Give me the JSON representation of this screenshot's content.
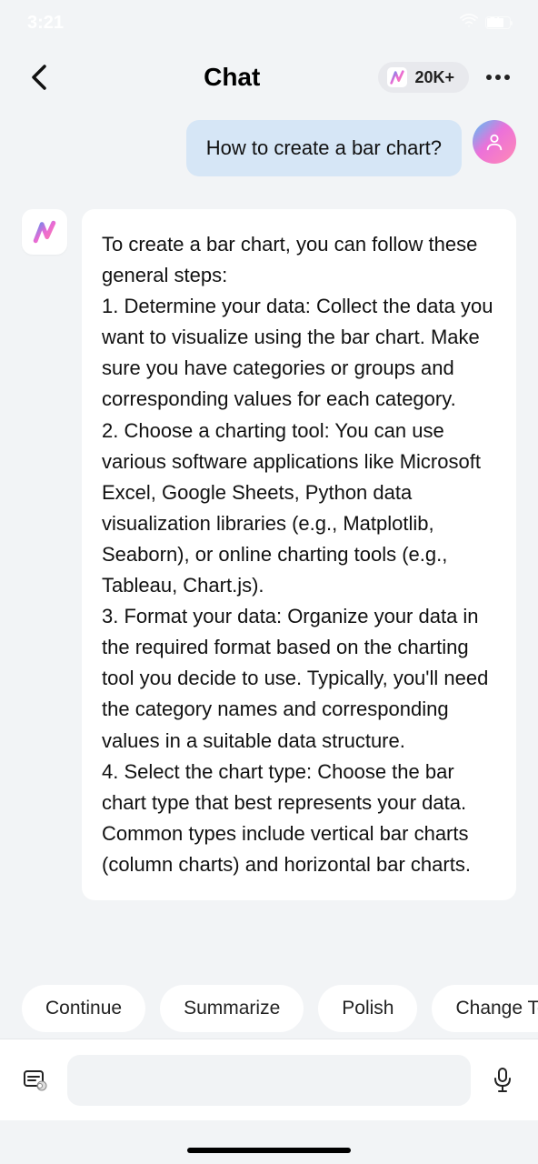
{
  "status": {
    "time": "3:21",
    "battery": "74"
  },
  "nav": {
    "title": "Chat",
    "count": "20K+"
  },
  "chat": {
    "userMessage": "How to create a bar chart?",
    "botIntro": "To create a bar chart, you can follow these general steps:",
    "botSteps": [
      "1. Determine your data: Collect the data you want to visualize using the bar chart. Make sure you have categories or groups and corresponding values for each category.",
      "2. Choose a charting tool: You can use various software applications like Microsoft Excel, Google Sheets, Python data visualization libraries (e.g., Matplotlib, Seaborn), or online charting tools (e.g., Tableau, Chart.js).",
      "3. Format your data: Organize your data in the required format based on the charting tool you decide to use. Typically, you'll need the category names and corresponding values in a suitable data structure.",
      "4. Select the chart type: Choose the bar chart type that best represents your data. Common types include vertical bar charts (column charts) and horizontal bar charts."
    ]
  },
  "suggestions": {
    "items": [
      "Continue",
      "Summarize",
      "Polish",
      "Change To"
    ]
  },
  "input": {
    "placeholder": ""
  }
}
